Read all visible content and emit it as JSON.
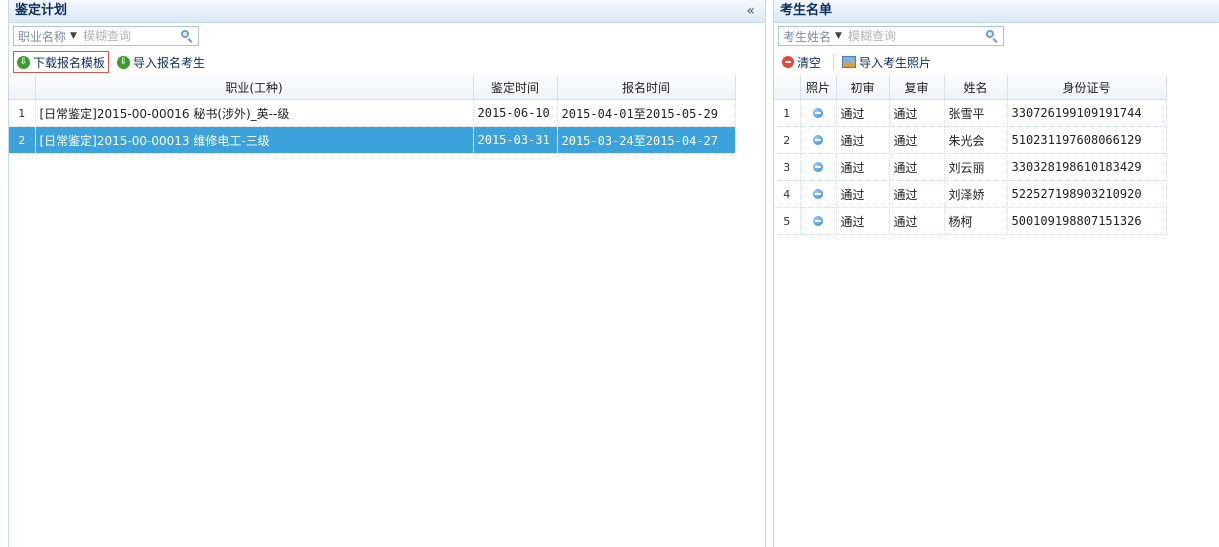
{
  "left": {
    "title": "鉴定计划",
    "collapse_glyph": "«",
    "search": {
      "field": "职业名称",
      "placeholder": "模糊查询"
    },
    "toolbar": {
      "download_label": "下载报名模板",
      "import_label": "导入报名考生"
    },
    "columns": [
      "职业(工种)",
      "鉴定时间",
      "报名时间"
    ],
    "rows": [
      {
        "no": "1",
        "name": "[日常鉴定]2015-00-00016 秘书(涉外)_英--级",
        "exam_date": "2015-06-10",
        "reg_period": "2015-04-01至2015-05-29"
      },
      {
        "no": "2",
        "name": "[日常鉴定]2015-00-00013 维修电工-三级",
        "exam_date": "2015-03-31",
        "reg_period": "2015-03-24至2015-04-27",
        "selected": true
      }
    ]
  },
  "right": {
    "title": "考生名单",
    "search": {
      "field": "考生姓名",
      "placeholder": "模糊查询"
    },
    "toolbar": {
      "clear_label": "清空",
      "import_photo_label": "导入考生照片"
    },
    "columns": [
      "照片",
      "初审",
      "复审",
      "姓名",
      "身份证号"
    ],
    "rows": [
      {
        "no": "1",
        "first": "通过",
        "second": "通过",
        "name": "张雪平",
        "id": "330726199109191744"
      },
      {
        "no": "2",
        "first": "通过",
        "second": "通过",
        "name": "朱光会",
        "id": "510231197608066129"
      },
      {
        "no": "3",
        "first": "通过",
        "second": "通过",
        "name": "刘云丽",
        "id": "330328198610183429"
      },
      {
        "no": "4",
        "first": "通过",
        "second": "通过",
        "name": "刘泽娇",
        "id": "522527198903210920"
      },
      {
        "no": "5",
        "first": "通过",
        "second": "通过",
        "name": "杨柯",
        "id": "500109198807151326"
      }
    ]
  },
  "colors": {
    "selected_row": "#3ba2db",
    "header_text": "#0e2d5f",
    "border": "#c5d9f1"
  },
  "icons": {
    "download": "green-download-icon",
    "import": "green-import-icon",
    "clear": "red-minus-icon",
    "photo_import": "photo-icon",
    "photo_cell": "blue-info-dot-icon"
  }
}
